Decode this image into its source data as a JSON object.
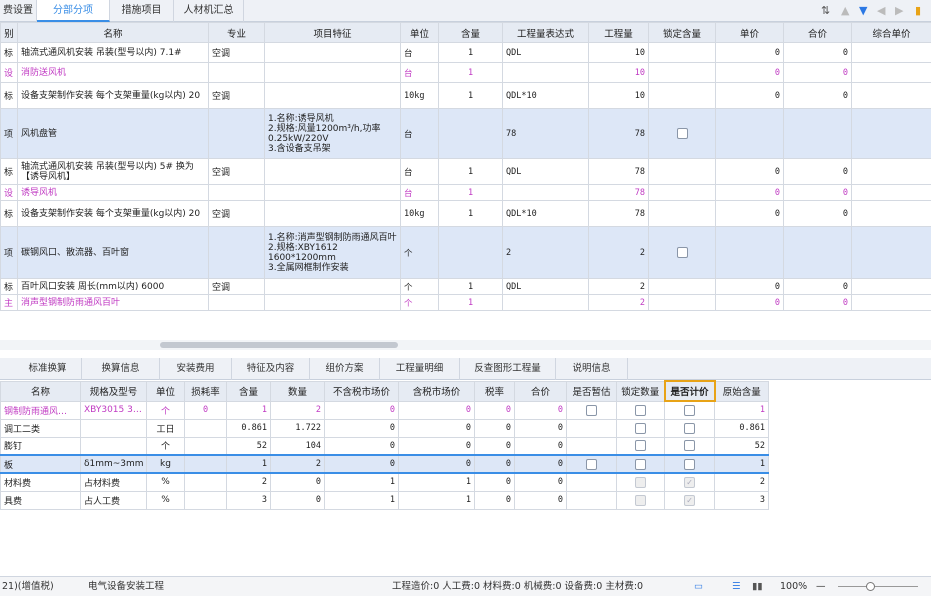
{
  "top_tabs": [
    "费设置",
    "分部分项",
    "措施项目",
    "人材机汇总"
  ],
  "main_headers": [
    "别",
    "名称",
    "专业",
    "项目特征",
    "单位",
    "含量",
    "工程量表达式",
    "工程量",
    "锁定含量",
    "单价",
    "合价",
    "综合单价"
  ],
  "main_rows": [
    {
      "type": "标",
      "name": "轴流式通风机安装 吊装(型号以内) 7.1#",
      "major": "空调",
      "feature": "",
      "unit": "台",
      "qty": "1",
      "expr": "QDL",
      "amount": "10",
      "lock": "",
      "price": "0",
      "total": "0",
      "sub": false,
      "sel": false
    },
    {
      "type": "设",
      "name": "消防送风机",
      "major": "",
      "feature": "",
      "unit": "台",
      "qty": "1",
      "expr": "",
      "amount": "10",
      "lock": "",
      "price": "0",
      "total": "0",
      "sub": true,
      "sel": false
    },
    {
      "type": "标",
      "name": "设备支架制作安装 每个支架重量(kg以内) 20",
      "major": "空调",
      "feature": "",
      "unit": "10kg",
      "qty": "1",
      "expr": "QDL*10",
      "amount": "10",
      "lock": "",
      "price": "0",
      "total": "0",
      "sub": false,
      "sel": false
    },
    {
      "type": "项",
      "name": "风机盘管",
      "major": "",
      "feature": "1.名称:诱导风机\n2.规格:风量1200m³/h,功率0.25kW/220V\n3.含设备支吊架",
      "unit": "台",
      "qty": "",
      "expr": "78",
      "amount": "78",
      "lock": "box",
      "price": "",
      "total": "",
      "sub": false,
      "sel": true
    },
    {
      "type": "标",
      "name": "轴流式通风机安装 吊装(型号以内) 5# 换为【诱导风机】",
      "major": "空调",
      "feature": "",
      "unit": "台",
      "qty": "1",
      "expr": "QDL",
      "amount": "78",
      "lock": "",
      "price": "0",
      "total": "0",
      "sub": false,
      "sel": false
    },
    {
      "type": "设",
      "name": "诱导风机",
      "major": "",
      "feature": "",
      "unit": "台",
      "qty": "1",
      "expr": "",
      "amount": "78",
      "lock": "",
      "price": "0",
      "total": "0",
      "sub": true,
      "sel": false
    },
    {
      "type": "标",
      "name": "设备支架制作安装 每个支架重量(kg以内) 20",
      "major": "空调",
      "feature": "",
      "unit": "10kg",
      "qty": "1",
      "expr": "QDL*10",
      "amount": "78",
      "lock": "",
      "price": "0",
      "total": "0",
      "sub": false,
      "sel": false
    },
    {
      "type": "项",
      "name": "碳钢风口、散流器、百叶窗",
      "major": "",
      "feature": "1.名称:消声型钢制防雨通风百叶\n2.规格:XBY1612 1600*1200mm\n3.全属网框制作安装",
      "unit": "个",
      "qty": "",
      "expr": "2",
      "amount": "2",
      "lock": "box",
      "price": "",
      "total": "",
      "sub": false,
      "sel": true
    },
    {
      "type": "标",
      "name": "百叶风口安装 周长(mm以内) 6000",
      "major": "空调",
      "feature": "",
      "unit": "个",
      "qty": "1",
      "expr": "QDL",
      "amount": "2",
      "lock": "",
      "price": "0",
      "total": "0",
      "sub": false,
      "sel": false
    },
    {
      "type": "主",
      "name": "消声型钢制防雨通风百叶",
      "major": "",
      "feature": "",
      "unit": "个",
      "qty": "1",
      "expr": "",
      "amount": "2",
      "lock": "",
      "price": "0",
      "total": "0",
      "sub": true,
      "sel": false
    }
  ],
  "bottom_tabs": [
    "标准换算",
    "换算信息",
    "安装费用",
    "特征及内容",
    "组价方案",
    "工程量明细",
    "反查图形工程量",
    "说明信息"
  ],
  "bottom_headers": [
    "名称",
    "规格及型号",
    "单位",
    "损耗率",
    "含量",
    "数量",
    "不含税市场价",
    "含税市场价",
    "税率",
    "合价",
    "是否暂估",
    "锁定数量",
    "是否计价",
    "原始含量"
  ],
  "bottom_rows": [
    {
      "name": "钢制防雨通风…",
      "spec": "XBY3015 3…",
      "unit": "个",
      "loss": "0",
      "qty": "1",
      "num": "2",
      "p1": "0",
      "p2": "0",
      "tax": "0",
      "total": "0",
      "est": "box",
      "lockn": "box",
      "price": "box",
      "orig": "1",
      "sub": true,
      "hl": false
    },
    {
      "name": "调工二类",
      "spec": "",
      "unit": "工日",
      "loss": "",
      "qty": "0.861",
      "num": "1.722",
      "p1": "0",
      "p2": "0",
      "tax": "0",
      "total": "0",
      "est": "",
      "lockn": "box",
      "price": "box",
      "orig": "0.861",
      "sub": false,
      "hl": false
    },
    {
      "name": "膨钉",
      "spec": "",
      "unit": "个",
      "loss": "",
      "qty": "52",
      "num": "104",
      "p1": "0",
      "p2": "0",
      "tax": "0",
      "total": "0",
      "est": "",
      "lockn": "box",
      "price": "box",
      "orig": "52",
      "sub": false,
      "hl": false
    },
    {
      "name": "板",
      "spec": "δ1mm~3mm",
      "unit": "kg",
      "loss": "",
      "qty": "1",
      "num": "2",
      "p1": "0",
      "p2": "0",
      "tax": "0",
      "total": "0",
      "est": "box",
      "lockn": "box",
      "price": "box",
      "orig": "1",
      "sub": false,
      "hl": true
    },
    {
      "name": "材料费",
      "spec": "占材料费",
      "unit": "%",
      "loss": "",
      "qty": "2",
      "num": "0",
      "p1": "1",
      "p2": "1",
      "tax": "0",
      "total": "0",
      "est": "",
      "lockn": "dis",
      "price": "chk",
      "orig": "2",
      "sub": false,
      "hl": false
    },
    {
      "name": "具费",
      "spec": "占人工费",
      "unit": "%",
      "loss": "",
      "qty": "3",
      "num": "0",
      "p1": "1",
      "p2": "1",
      "tax": "0",
      "total": "0",
      "est": "",
      "lockn": "dis",
      "price": "chk",
      "orig": "3",
      "sub": false,
      "hl": false
    }
  ],
  "status": {
    "left1": "21)(增值税)",
    "left2": "电气设备安装工程",
    "summary": "工程造价:0 人工费:0 材料费:0 机械费:0 设备费:0 主材费:0",
    "zoom": "100%"
  }
}
